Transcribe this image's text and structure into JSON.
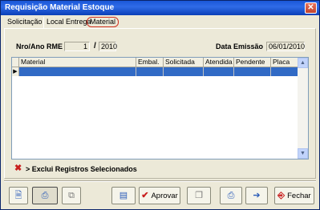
{
  "window": {
    "title": "Requisição Material Estoque",
    "close_glyph": "✕"
  },
  "tabs": [
    {
      "label": "Solicitação"
    },
    {
      "label": "Local Entrega"
    },
    {
      "label": "Material"
    }
  ],
  "form": {
    "nro_ano_label": "Nro/Ano RME",
    "nro_value": "1",
    "separator": "/",
    "ano_value": "2010",
    "data_emissao_label": "Data Emissão",
    "data_emissao_value": "06/01/2010"
  },
  "grid": {
    "columns": [
      "Material",
      "Embal.",
      "Solicitada",
      "Atendida",
      "Pendente",
      "Placa"
    ],
    "row_indicator": "▶",
    "rows": [
      [
        "",
        "",
        "",
        "",
        "",
        ""
      ]
    ]
  },
  "delete_selected": {
    "label": "> Exclui Registros Selecionados",
    "icon": "x-icon"
  },
  "toolbar": {
    "aprovar_label": "Aprovar",
    "fechar_label": "Fechar",
    "icons": [
      "document-icon",
      "print-preview-icon",
      "copy-icon",
      "book-icon",
      "checkmark-icon",
      "document-stack-icon",
      "printer-icon",
      "export-icon",
      "exit-door-icon"
    ]
  },
  "scrollbar": {
    "up_glyph": "▲",
    "down_glyph": "▼"
  },
  "colors": {
    "selection": "#316ac5",
    "titlebar": "#2f6be7",
    "accent_red": "#c81e1e"
  }
}
